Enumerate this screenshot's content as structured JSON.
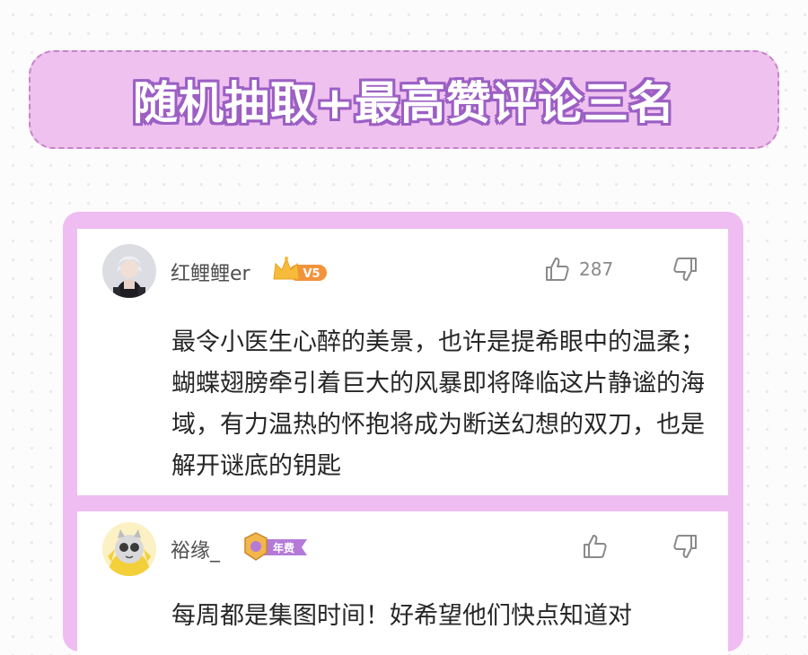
{
  "banner": {
    "title": "随机抽取+最高赞评论三名"
  },
  "comments": [
    {
      "username": "红鲤鲤er",
      "badge_text": "V5",
      "likes": "287",
      "text": "最令小医生心醉的美景，也许是提希眼中的温柔；蝴蝶翅膀牵引着巨大的风暴即将降临这片静谧的海域，有力温热的怀抱将成为断送幻想的双刀，也是解开谜底的钥匙"
    },
    {
      "username": "裕缘_",
      "badge_text": "年费",
      "likes": "",
      "text": "每周都是集图时间！好希望他们快点知道对"
    }
  ],
  "colors": {
    "banner_fill": "#efc1ef",
    "banner_border": "#c585c8",
    "title_outline": "#9c5fc4",
    "panel": "#efbdf1",
    "card": "#ffffff",
    "crown": "#f6bb3a",
    "v_badge": "#f2933c",
    "annual_badge": "#b57ad8"
  },
  "icons": [
    "thumbs-up-icon",
    "thumbs-down-icon",
    "crown-icon",
    "annual-member-icon"
  ]
}
